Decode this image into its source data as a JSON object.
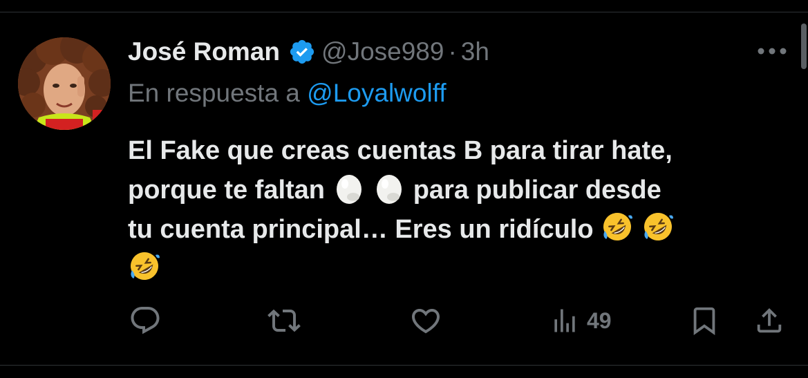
{
  "tweet": {
    "display_name": "José Roman",
    "handle": "@Jose989",
    "separator": "·",
    "time": "3h",
    "reply_prefix": "En respuesta a",
    "reply_to": "@Loyalwolff",
    "text_lines": [
      "El Fake que creas cuentas B para tirar hate,",
      "porque te faltan",
      "para publicar desde",
      "tu cuenta principal… Eres un ridículo"
    ],
    "emojis": [
      "egg",
      "egg",
      "rolling-on-floor-laughing",
      "rolling-on-floor-laughing",
      "rolling-on-floor-laughing"
    ]
  },
  "actions": {
    "views_count": "49",
    "icons": [
      "reply-icon",
      "retweet-icon",
      "like-icon",
      "views-icon",
      "bookmark-icon",
      "share-icon"
    ]
  },
  "colors": {
    "background": "#000000",
    "text": "#e7e9ea",
    "secondary": "#71767b",
    "link": "#1d9bf0",
    "verified": "#1d9bf0",
    "divider": "#2f3336"
  }
}
